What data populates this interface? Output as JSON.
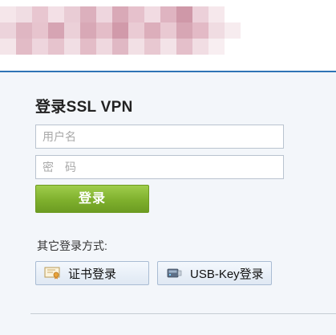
{
  "login": {
    "title": "登录SSL VPN",
    "username_placeholder": "用户名",
    "password_placeholder": "密　码",
    "submit_label": "登录"
  },
  "alt_login": {
    "label": "其它登录方式:",
    "certificate_label": "证书登录",
    "usbkey_label": "USB-Key登录"
  },
  "icons": {
    "certificate": "certificate-icon",
    "usbkey": "usb-key-icon"
  },
  "colors": {
    "accent": "#2f74b5",
    "login_button": "#86b834"
  }
}
